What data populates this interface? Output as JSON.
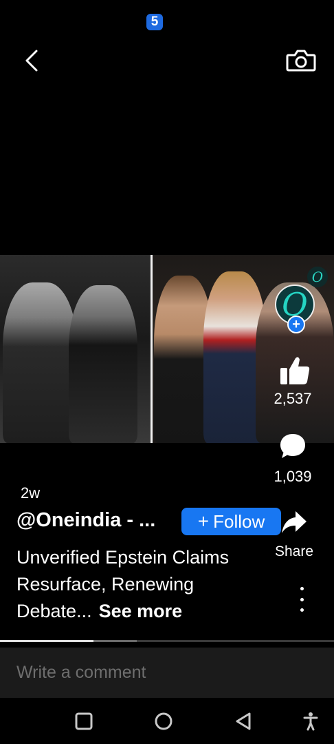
{
  "status_bar": {
    "badge_text": "5"
  },
  "header": {
    "back_icon": "chevron-left-icon",
    "camera_icon": "camera-icon"
  },
  "media": {
    "watermark": "O"
  },
  "post": {
    "time_ago": "2w",
    "author": "@Oneindia - ...",
    "follow_label": "Follow",
    "follow_icon": "plus-icon",
    "caption": "Unverified Epstein Claims Resurface, Renewing Debate...",
    "see_more": "See more"
  },
  "actions": {
    "avatar_letter": "O",
    "likes": "2,537",
    "comments": "1,039",
    "share_label": "Share"
  },
  "progress": {
    "played_fraction": 0.28,
    "buffered_fraction": 0.41
  },
  "comment_bar": {
    "placeholder": "Write a comment"
  },
  "colors": {
    "accent": "#1877f2",
    "background": "#000000"
  }
}
